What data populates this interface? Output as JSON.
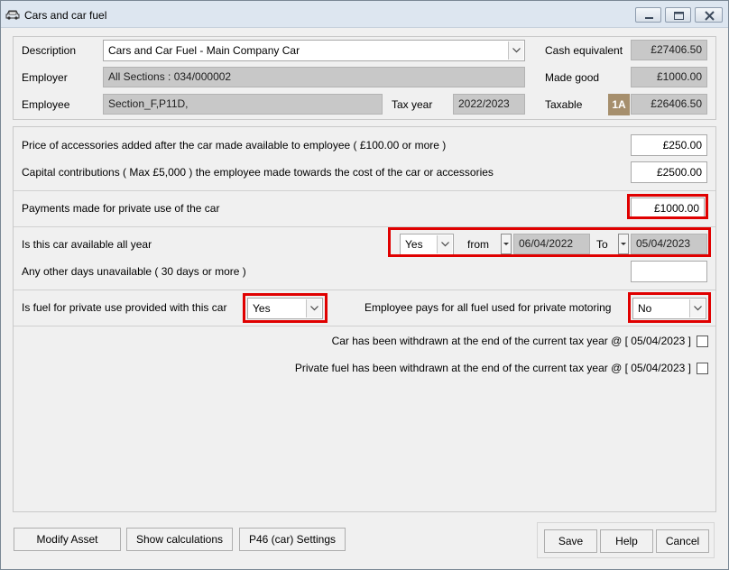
{
  "window": {
    "title": "Cars and car fuel",
    "icon": "car-icon",
    "controls": [
      "minimize-icon",
      "maximize-icon",
      "close-icon"
    ]
  },
  "header": {
    "description_label": "Description",
    "description_value": "Cars and Car Fuel - Main Company Car",
    "employer_label": "Employer",
    "employer_value": "All Sections : 034/000002",
    "employee_label": "Employee",
    "employee_value": "Section_F,P11D,",
    "tax_year_label": "Tax year",
    "tax_year_value": "2022/2023",
    "cash_equivalent_label": "Cash equivalent",
    "cash_equivalent_value": "£27406.50",
    "made_good_label": "Made good",
    "made_good_value": "£1000.00",
    "taxable_label": "Taxable",
    "taxable_badge": "1A",
    "taxable_value": "£26406.50"
  },
  "accessories": {
    "price_label": "Price of accessories added after the car made available to employee ( £100.00 or  more )",
    "price_value": "£250.00",
    "capital_label": "Capital contributions ( Max £5,000 ) the employee made towards the cost of the car or accessories",
    "capital_value": "£2500.00"
  },
  "payments": {
    "label": "Payments made for private use of the car",
    "value": "£1000.00"
  },
  "availability": {
    "all_year_label": "Is this car available all year",
    "all_year_value": "Yes",
    "from_label": "from",
    "from_value": "06/04/2022",
    "to_label": "To",
    "to_value": "05/04/2023",
    "other_days_label": "Any other days unavailable ( 30 days or more )",
    "other_days_value": ""
  },
  "fuel": {
    "provided_label": "Is fuel for private use provided with this car",
    "provided_value": "Yes",
    "employee_pays_label": "Employee pays for all fuel used for private motoring",
    "employee_pays_value": "No"
  },
  "withdrawn": {
    "car_label": "Car has been withdrawn at the end of the current tax year @ [ 05/04/2023 ]",
    "car_checked": false,
    "fuel_label": "Private fuel has been withdrawn at the end of the current tax year @ [ 05/04/2023 ]",
    "fuel_checked": false
  },
  "buttons": {
    "modify_asset": "Modify Asset",
    "show_calculations": "Show calculations",
    "p46_settings": "P46 (car) Settings",
    "save": "Save",
    "help": "Help",
    "cancel": "Cancel"
  },
  "colors": {
    "highlight": "#e00000",
    "readonly_bg": "#c8c8c8",
    "badge_bg": "#a68f6d",
    "window_bg": "#f0f0f0"
  }
}
